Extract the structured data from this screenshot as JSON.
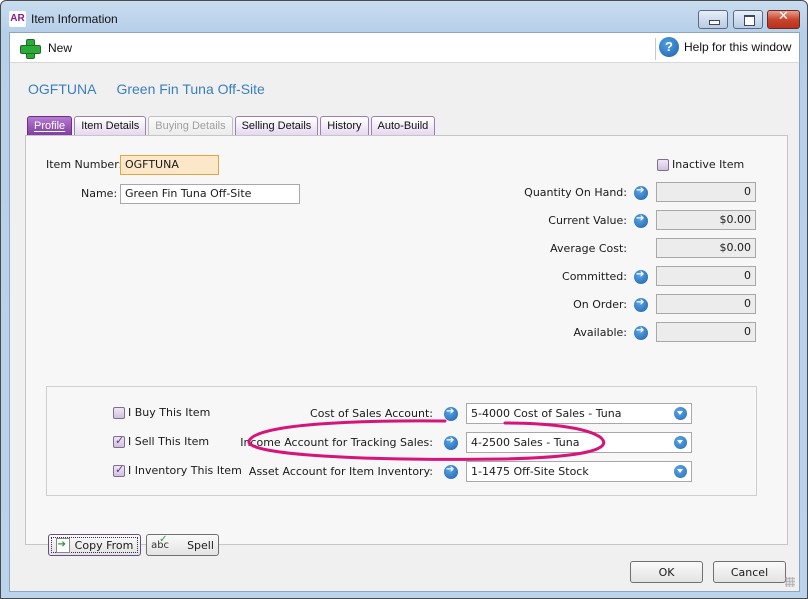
{
  "window": {
    "app_logo": "AR",
    "title": "Item Information",
    "controls": {
      "minimize": "minimize",
      "maximize": "maximize",
      "close": "✕"
    }
  },
  "toolbar": {
    "new_label": "New",
    "help_label": "Help for this window",
    "help_glyph": "?"
  },
  "heading": {
    "item_number": "OGFTUNA",
    "item_name": "Green Fin Tuna Off-Site"
  },
  "tabs": [
    {
      "label": "Profile",
      "state": "active"
    },
    {
      "label": "Item Details",
      "state": "normal"
    },
    {
      "label": "Buying Details",
      "state": "disabled"
    },
    {
      "label": "Selling Details",
      "state": "normal"
    },
    {
      "label": "History",
      "state": "normal"
    },
    {
      "label": "Auto-Build",
      "state": "normal"
    }
  ],
  "profile": {
    "item_number_label": "Item Number:",
    "item_number_value": "OGFTUNA",
    "name_label": "Name:",
    "name_value": "Green Fin Tuna Off-Site",
    "inactive_label": "Inactive Item",
    "inactive_checked": false,
    "stats": [
      {
        "label": "Quantity On Hand:",
        "value": "0",
        "has_link": true
      },
      {
        "label": "Current Value:",
        "value": "$0.00",
        "has_link": true
      },
      {
        "label": "Average Cost:",
        "value": "$0.00",
        "has_link": false
      },
      {
        "label": "Committed:",
        "value": "0",
        "has_link": true
      },
      {
        "label": "On Order:",
        "value": "0",
        "has_link": true
      },
      {
        "label": "Available:",
        "value": "0",
        "has_link": true
      }
    ]
  },
  "accounts": {
    "checkboxes": [
      {
        "label": "I Buy This Item",
        "checked": false
      },
      {
        "label": "I Sell This Item",
        "checked": true
      },
      {
        "label": "I Inventory This Item",
        "checked": true
      }
    ],
    "rows": [
      {
        "label": "Cost of Sales Account:",
        "value": "5-4000 Cost of Sales - Tuna"
      },
      {
        "label": "Income Account for Tracking Sales:",
        "value": "4-2500 Sales - Tuna"
      },
      {
        "label": "Asset Account for Item Inventory:",
        "value": "1-1475 Off-Site Stock"
      }
    ],
    "annotation_color": "#d6157a"
  },
  "buttons": {
    "copy_from": "Copy From",
    "spell": "Spell",
    "spell_glyph": "abc",
    "ok": "OK",
    "cancel": "Cancel"
  }
}
